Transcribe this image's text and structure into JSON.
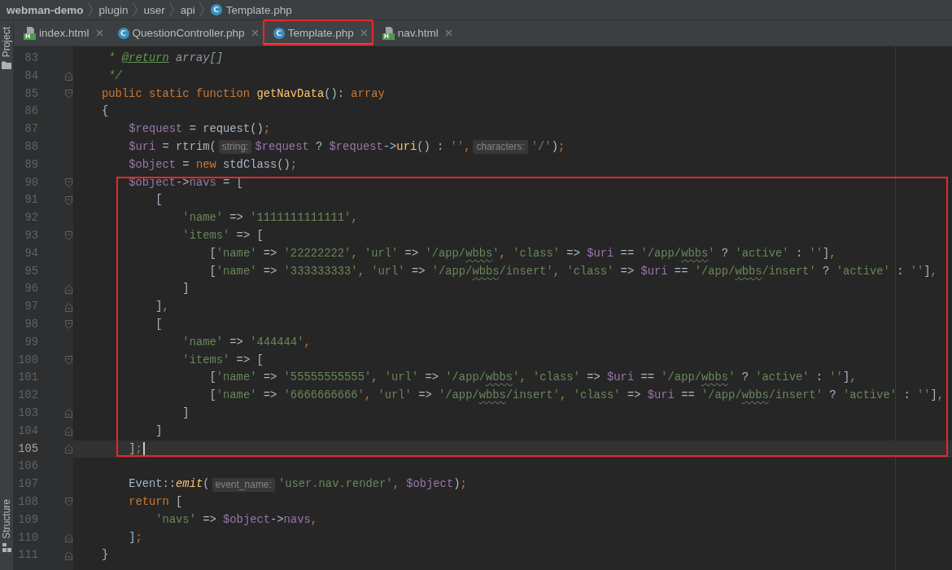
{
  "breadcrumbs": [
    {
      "text": "webman-demo",
      "kind": "project"
    },
    {
      "text": "plugin",
      "kind": "folder"
    },
    {
      "text": "user",
      "kind": "folder"
    },
    {
      "text": "api",
      "kind": "folder"
    },
    {
      "text": "Template.php",
      "kind": "file",
      "icon": {
        "kind": "class",
        "letter": "C"
      }
    }
  ],
  "tabs": [
    {
      "label": "index.html",
      "icon": {
        "kind": "html",
        "letter": "H"
      },
      "selected": false,
      "highlighted": false
    },
    {
      "label": "QuestionController.php",
      "icon": {
        "kind": "class",
        "letter": "C"
      },
      "selected": false,
      "highlighted": false
    },
    {
      "label": "Template.php",
      "icon": {
        "kind": "class",
        "letter": "C"
      },
      "selected": true,
      "highlighted": true
    },
    {
      "label": "nav.html",
      "icon": {
        "kind": "html",
        "letter": "H"
      },
      "selected": false,
      "highlighted": false
    }
  ],
  "tool_strip": {
    "top": [
      {
        "label": "Project",
        "kind": "project"
      }
    ],
    "bottom": [
      {
        "label": "Structure",
        "kind": "structure"
      }
    ]
  },
  "editor": {
    "sections": [
      {
        "boxed": false,
        "lines": [
          {
            "number": "83",
            "kind": "plain",
            "current": false,
            "tokens": [
              {
                "kind": "doc",
                "text": " * "
              },
              {
                "kind": "doc-tag",
                "text": "@return"
              },
              {
                "kind": "doc-type",
                "text": " array[]"
              }
            ]
          },
          {
            "number": "84",
            "kind": "block-end",
            "current": false,
            "tokens": [
              {
                "kind": "doc",
                "text": " */"
              }
            ]
          },
          {
            "number": "85",
            "kind": "block-start",
            "current": false,
            "tokens": [
              {
                "kind": "keyword",
                "text": "public static function "
              },
              {
                "kind": "fn",
                "text": "getNavData"
              },
              {
                "kind": "plain",
                "text": "(): "
              },
              {
                "kind": "keyword",
                "text": "array"
              }
            ]
          },
          {
            "number": "86",
            "kind": "plain",
            "current": false,
            "tokens": [
              {
                "kind": "plain",
                "text": "{"
              }
            ]
          },
          {
            "number": "87",
            "kind": "plain",
            "current": false,
            "tokens": [
              {
                "kind": "var",
                "text": "    $request"
              },
              {
                "kind": "plain",
                "text": " = request()"
              },
              {
                "kind": "punct",
                "text": ";"
              }
            ]
          },
          {
            "number": "88",
            "kind": "plain",
            "current": false,
            "tokens": [
              {
                "kind": "var",
                "text": "    $uri"
              },
              {
                "kind": "plain",
                "text": " = rtrim("
              },
              {
                "kind": "hint",
                "text": "string:"
              },
              {
                "kind": "var",
                "text": "$request"
              },
              {
                "kind": "plain",
                "text": " ? "
              },
              {
                "kind": "var",
                "text": "$request"
              },
              {
                "kind": "plain",
                "text": "->"
              },
              {
                "kind": "call",
                "text": "uri"
              },
              {
                "kind": "plain",
                "text": "() : "
              },
              {
                "kind": "string",
                "text": "''"
              },
              {
                "kind": "punct",
                "text": ","
              },
              {
                "kind": "hint",
                "text": "characters:"
              },
              {
                "kind": "string",
                "text": "'/'"
              },
              {
                "kind": "plain",
                "text": ")"
              },
              {
                "kind": "punct",
                "text": ";"
              }
            ]
          },
          {
            "number": "89",
            "kind": "plain",
            "current": false,
            "tokens": [
              {
                "kind": "var",
                "text": "    $object"
              },
              {
                "kind": "plain",
                "text": " = "
              },
              {
                "kind": "keyword",
                "text": "new"
              },
              {
                "kind": "plain",
                "text": " stdClass()"
              },
              {
                "kind": "punct",
                "text": ";"
              }
            ]
          }
        ]
      },
      {
        "boxed": true,
        "lines": [
          {
            "number": "90",
            "kind": "block-start",
            "current": false,
            "tokens": [
              {
                "kind": "var",
                "text": "    $object"
              },
              {
                "kind": "plain",
                "text": "->"
              },
              {
                "kind": "field",
                "text": "navs"
              },
              {
                "kind": "plain",
                "text": " = ["
              }
            ]
          },
          {
            "number": "91",
            "kind": "block-start",
            "current": false,
            "tokens": [
              {
                "kind": "plain",
                "text": "        ["
              }
            ]
          },
          {
            "number": "92",
            "kind": "plain",
            "current": false,
            "tokens": [
              {
                "kind": "string",
                "text": "            'name'"
              },
              {
                "kind": "plain",
                "text": " => "
              },
              {
                "kind": "string",
                "text": "'1111111111111'"
              },
              {
                "kind": "punct",
                "text": ","
              }
            ]
          },
          {
            "number": "93",
            "kind": "block-start",
            "current": false,
            "tokens": [
              {
                "kind": "string",
                "text": "            'items'"
              },
              {
                "kind": "plain",
                "text": " => ["
              }
            ]
          },
          {
            "number": "94",
            "kind": "plain",
            "current": false,
            "tokens": [
              {
                "kind": "plain",
                "text": "                ["
              },
              {
                "kind": "string",
                "text": "'name'"
              },
              {
                "kind": "plain",
                "text": " => "
              },
              {
                "kind": "string",
                "text": "'22222222'"
              },
              {
                "kind": "punct",
                "text": ", "
              },
              {
                "kind": "string",
                "text": "'url'"
              },
              {
                "kind": "plain",
                "text": " => "
              },
              {
                "kind": "string",
                "text": "'/app/"
              },
              {
                "kind": "string-typo",
                "text": "wbbs"
              },
              {
                "kind": "string",
                "text": "'"
              },
              {
                "kind": "punct",
                "text": ", "
              },
              {
                "kind": "string",
                "text": "'class'"
              },
              {
                "kind": "plain",
                "text": " => "
              },
              {
                "kind": "var",
                "text": "$uri"
              },
              {
                "kind": "plain",
                "text": " == "
              },
              {
                "kind": "string",
                "text": "'/app/"
              },
              {
                "kind": "string-typo",
                "text": "wbbs"
              },
              {
                "kind": "string",
                "text": "'"
              },
              {
                "kind": "plain",
                "text": " ? "
              },
              {
                "kind": "string",
                "text": "'active'"
              },
              {
                "kind": "plain",
                "text": " : "
              },
              {
                "kind": "string",
                "text": "''"
              },
              {
                "kind": "plain",
                "text": "]"
              },
              {
                "kind": "punct",
                "text": ","
              }
            ]
          },
          {
            "number": "95",
            "kind": "plain",
            "current": false,
            "tokens": [
              {
                "kind": "plain",
                "text": "                ["
              },
              {
                "kind": "string",
                "text": "'name'"
              },
              {
                "kind": "plain",
                "text": " => "
              },
              {
                "kind": "string",
                "text": "'333333333'"
              },
              {
                "kind": "punct",
                "text": ", "
              },
              {
                "kind": "string",
                "text": "'url'"
              },
              {
                "kind": "plain",
                "text": " => "
              },
              {
                "kind": "string",
                "text": "'/app/"
              },
              {
                "kind": "string-typo",
                "text": "wbbs"
              },
              {
                "kind": "string",
                "text": "/insert'"
              },
              {
                "kind": "punct",
                "text": ", "
              },
              {
                "kind": "string",
                "text": "'class'"
              },
              {
                "kind": "plain",
                "text": " => "
              },
              {
                "kind": "var",
                "text": "$uri"
              },
              {
                "kind": "plain",
                "text": " == "
              },
              {
                "kind": "string",
                "text": "'/app/"
              },
              {
                "kind": "string-typo",
                "text": "wbbs"
              },
              {
                "kind": "string",
                "text": "/insert'"
              },
              {
                "kind": "plain",
                "text": " ? "
              },
              {
                "kind": "string",
                "text": "'active'"
              },
              {
                "kind": "plain",
                "text": " : "
              },
              {
                "kind": "string",
                "text": "''"
              },
              {
                "kind": "plain",
                "text": "]"
              },
              {
                "kind": "punct",
                "text": ","
              }
            ]
          },
          {
            "number": "96",
            "kind": "block-end",
            "current": false,
            "tokens": [
              {
                "kind": "plain",
                "text": "            ]"
              }
            ]
          },
          {
            "number": "97",
            "kind": "block-end",
            "current": false,
            "tokens": [
              {
                "kind": "plain",
                "text": "        ]"
              },
              {
                "kind": "punct",
                "text": ","
              }
            ]
          },
          {
            "number": "98",
            "kind": "block-start",
            "current": false,
            "tokens": [
              {
                "kind": "plain",
                "text": "        ["
              }
            ]
          },
          {
            "number": "99",
            "kind": "plain",
            "current": false,
            "tokens": [
              {
                "kind": "string",
                "text": "            'name'"
              },
              {
                "kind": "plain",
                "text": " => "
              },
              {
                "kind": "string",
                "text": "'444444'"
              },
              {
                "kind": "punct",
                "text": ","
              }
            ]
          },
          {
            "number": "100",
            "kind": "block-start",
            "current": false,
            "tokens": [
              {
                "kind": "string",
                "text": "            'items'"
              },
              {
                "kind": "plain",
                "text": " => ["
              }
            ]
          },
          {
            "number": "101",
            "kind": "plain",
            "current": false,
            "tokens": [
              {
                "kind": "plain",
                "text": "                ["
              },
              {
                "kind": "string",
                "text": "'name'"
              },
              {
                "kind": "plain",
                "text": " => "
              },
              {
                "kind": "string",
                "text": "'55555555555'"
              },
              {
                "kind": "punct",
                "text": ", "
              },
              {
                "kind": "string",
                "text": "'url'"
              },
              {
                "kind": "plain",
                "text": " => "
              },
              {
                "kind": "string",
                "text": "'/app/"
              },
              {
                "kind": "string-typo",
                "text": "wbbs"
              },
              {
                "kind": "string",
                "text": "'"
              },
              {
                "kind": "punct",
                "text": ", "
              },
              {
                "kind": "string",
                "text": "'class'"
              },
              {
                "kind": "plain",
                "text": " => "
              },
              {
                "kind": "var",
                "text": "$uri"
              },
              {
                "kind": "plain",
                "text": " == "
              },
              {
                "kind": "string",
                "text": "'/app/"
              },
              {
                "kind": "string-typo",
                "text": "wbbs"
              },
              {
                "kind": "string",
                "text": "'"
              },
              {
                "kind": "plain",
                "text": " ? "
              },
              {
                "kind": "string",
                "text": "'active'"
              },
              {
                "kind": "plain",
                "text": " : "
              },
              {
                "kind": "string",
                "text": "''"
              },
              {
                "kind": "plain",
                "text": "]"
              },
              {
                "kind": "punct",
                "text": ","
              }
            ]
          },
          {
            "number": "102",
            "kind": "plain",
            "current": false,
            "tokens": [
              {
                "kind": "plain",
                "text": "                ["
              },
              {
                "kind": "string",
                "text": "'name'"
              },
              {
                "kind": "plain",
                "text": " => "
              },
              {
                "kind": "string",
                "text": "'6666666666'"
              },
              {
                "kind": "punct",
                "text": ", "
              },
              {
                "kind": "string",
                "text": "'url'"
              },
              {
                "kind": "plain",
                "text": " => "
              },
              {
                "kind": "string",
                "text": "'/app/"
              },
              {
                "kind": "string-typo",
                "text": "wbbs"
              },
              {
                "kind": "string",
                "text": "/insert'"
              },
              {
                "kind": "punct",
                "text": ", "
              },
              {
                "kind": "string",
                "text": "'class'"
              },
              {
                "kind": "plain",
                "text": " => "
              },
              {
                "kind": "var",
                "text": "$uri"
              },
              {
                "kind": "plain",
                "text": " == "
              },
              {
                "kind": "string",
                "text": "'/app/"
              },
              {
                "kind": "string-typo",
                "text": "wbbs"
              },
              {
                "kind": "string",
                "text": "/insert'"
              },
              {
                "kind": "plain",
                "text": " ? "
              },
              {
                "kind": "string",
                "text": "'active'"
              },
              {
                "kind": "plain",
                "text": " : "
              },
              {
                "kind": "string",
                "text": "''"
              },
              {
                "kind": "plain",
                "text": "]"
              },
              {
                "kind": "punct",
                "text": ","
              }
            ]
          },
          {
            "number": "103",
            "kind": "block-end",
            "current": false,
            "tokens": [
              {
                "kind": "plain",
                "text": "            ]"
              }
            ]
          },
          {
            "number": "104",
            "kind": "block-end",
            "current": false,
            "tokens": [
              {
                "kind": "plain",
                "text": "        ]"
              }
            ]
          },
          {
            "number": "105",
            "kind": "block-end",
            "current": true,
            "tokens": [
              {
                "kind": "plain",
                "text": "    ]"
              },
              {
                "kind": "punct",
                "text": ";"
              }
            ]
          }
        ]
      },
      {
        "boxed": false,
        "lines": [
          {
            "number": "106",
            "kind": "plain",
            "current": false
          },
          {
            "number": "107",
            "kind": "plain",
            "current": false,
            "tokens": [
              {
                "kind": "plain",
                "text": "    Event::"
              },
              {
                "kind": "static-call",
                "text": "emit"
              },
              {
                "kind": "plain",
                "text": "("
              },
              {
                "kind": "hint",
                "text": "event_name:"
              },
              {
                "kind": "string",
                "text": "'user.nav.render'"
              },
              {
                "kind": "punct",
                "text": ", "
              },
              {
                "kind": "var",
                "text": "$object"
              },
              {
                "kind": "plain",
                "text": ")"
              },
              {
                "kind": "punct",
                "text": ";"
              }
            ]
          },
          {
            "number": "108",
            "kind": "block-start",
            "current": false,
            "tokens": [
              {
                "kind": "keyword",
                "text": "    return"
              },
              {
                "kind": "plain",
                "text": " ["
              }
            ]
          },
          {
            "number": "109",
            "kind": "plain",
            "current": false,
            "tokens": [
              {
                "kind": "string",
                "text": "        'navs'"
              },
              {
                "kind": "plain",
                "text": " => "
              },
              {
                "kind": "var",
                "text": "$object"
              },
              {
                "kind": "plain",
                "text": "->"
              },
              {
                "kind": "field",
                "text": "navs"
              },
              {
                "kind": "punct",
                "text": ","
              }
            ]
          },
          {
            "number": "110",
            "kind": "block-end",
            "current": false,
            "tokens": [
              {
                "kind": "plain",
                "text": "    ]"
              },
              {
                "kind": "punct",
                "text": ";"
              }
            ]
          },
          {
            "number": "111",
            "kind": "block-end",
            "current": false,
            "tokens": [
              {
                "kind": "plain",
                "text": "}"
              }
            ]
          }
        ]
      }
    ]
  }
}
